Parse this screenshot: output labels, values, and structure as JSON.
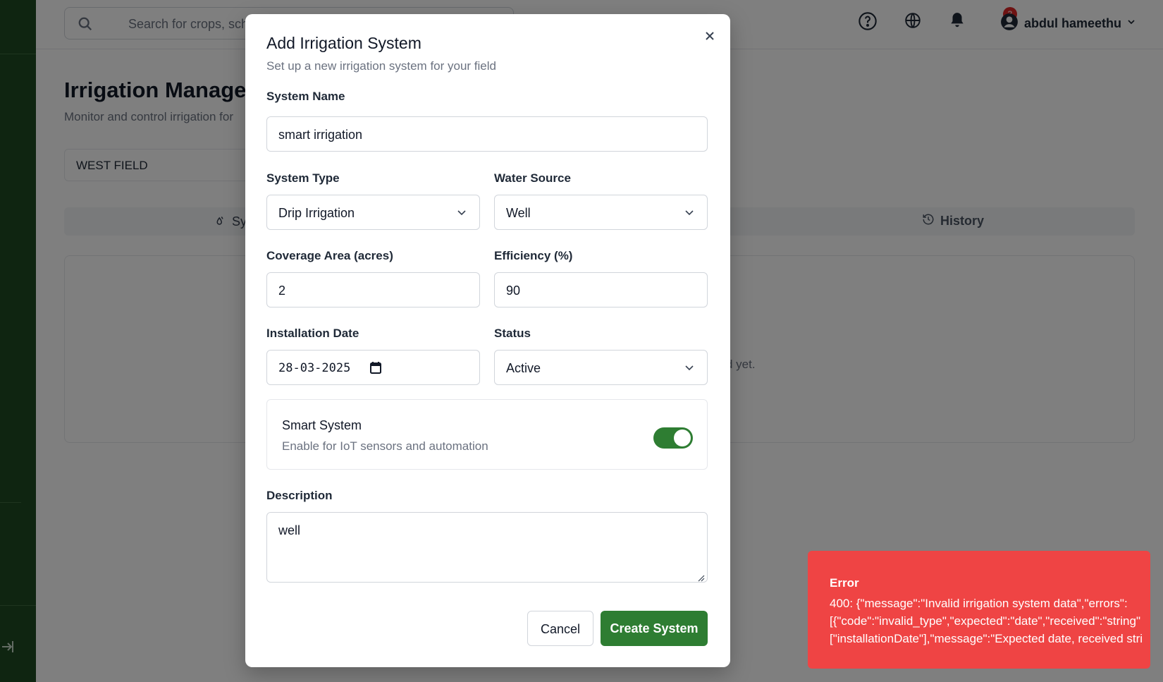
{
  "topbar": {
    "search_placeholder": "Search for crops, schemes,",
    "notification_count": "3",
    "user_name": "abdul hameethu"
  },
  "page": {
    "title": "Irrigation Manage",
    "subtitle": "Monitor and control irrigation for",
    "field_select": "WEST FIELD",
    "tab_systems": "Sy",
    "tab_history": "History",
    "empty_text": "d yet."
  },
  "modal": {
    "title": "Add Irrigation System",
    "subtitle": "Set up a new irrigation system for your field",
    "system_name_label": "System Name",
    "system_name_value": "smart irrigation",
    "system_type_label": "System Type",
    "system_type_value": "Drip Irrigation",
    "water_source_label": "Water Source",
    "water_source_value": "Well",
    "coverage_label": "Coverage Area (acres)",
    "coverage_value": "2",
    "efficiency_label": "Efficiency (%)",
    "efficiency_value": "90",
    "install_date_label": "Installation Date",
    "install_date_value": "28-03-2025",
    "status_label": "Status",
    "status_value": "Active",
    "smart_title": "Smart System",
    "smart_subtitle": "Enable for IoT sensors and automation",
    "smart_enabled": true,
    "description_label": "Description",
    "description_value": "well",
    "cancel_label": "Cancel",
    "create_label": "Create System"
  },
  "toast": {
    "title": "Error",
    "line1": "400: {\"message\":\"Invalid irrigation system data\",\"errors\":",
    "line2": "[{\"code\":\"invalid_type\",\"expected\":\"date\",\"received\":\"string\"",
    "line3": "[\"installationDate\"],\"message\":\"Expected date, received stri"
  },
  "colors": {
    "brand_green": "#2e7d32",
    "sidebar_green": "#1f4a22",
    "error_red": "#ef4444"
  }
}
